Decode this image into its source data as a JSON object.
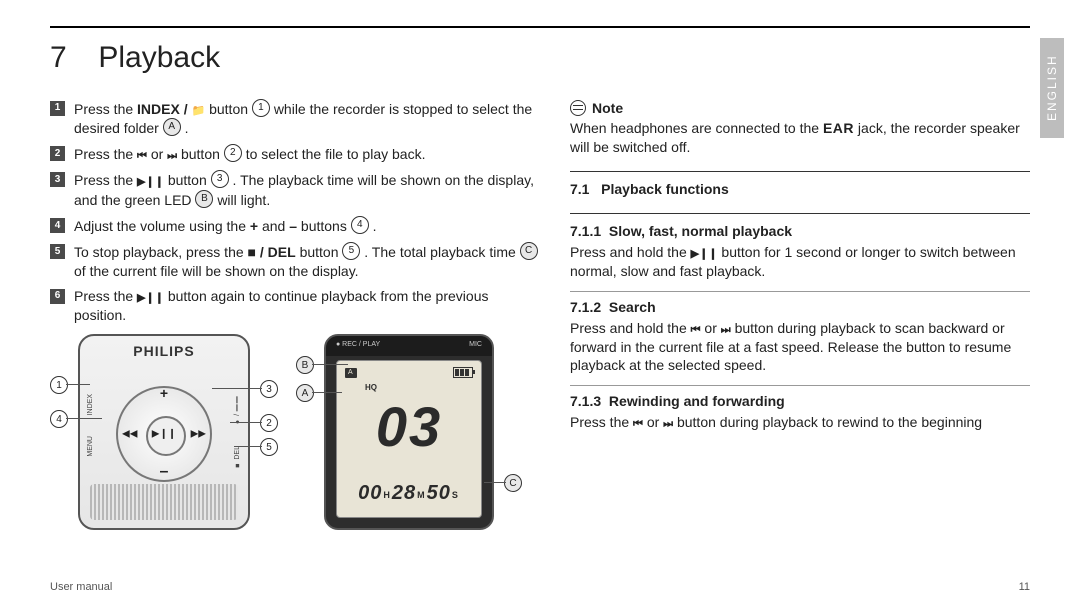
{
  "sideTab": "ENGLISH",
  "chapter": {
    "num": "7",
    "title": "Playback"
  },
  "steps": [
    {
      "pre": "Press the ",
      "btn": "INDEX / ",
      "btnGlyph": "📁",
      "mid1": " button ",
      "ref": "1",
      "mid2": " while the recorder is stopped to select the desired folder ",
      "ref2": "A",
      "end": "."
    },
    {
      "pre": "Press the ",
      "g1": "⏮",
      "or": " or ",
      "g2": "⏭",
      "mid1": " button ",
      "ref": "2",
      "end": " to select the file to play back."
    },
    {
      "pre": "Press the ",
      "g1": "▶❙❙",
      "mid1": " button ",
      "ref": "3",
      "end": ". The playback time will be shown on the display, and the green LED ",
      "ref2": "B",
      "end2": " will light."
    },
    {
      "pre": "Adjust the volume using the ",
      "b1": "+",
      "and": " and ",
      "b2": "–",
      "mid1": " buttons ",
      "ref": "4",
      "end": "."
    },
    {
      "pre": "To stop playback, press the ",
      "btn": "■ / DEL",
      "mid1": " button ",
      "ref": "5",
      "end": ". The total playback time ",
      "ref2": "C",
      "end2": " of the current file will be shown on the display."
    },
    {
      "pre": "Press the ",
      "g1": "▶❙❙",
      "end": " button again to continue playback from the previous position."
    }
  ],
  "device": {
    "brand": "PHILIPS",
    "plus": "+",
    "minus": "–",
    "left": "◀◀",
    "right": "▶▶",
    "center": "▶❙❙",
    "sideLeft1": "INDEX",
    "sideLeft2": "MENU",
    "sideRight1": "● / ❙❙",
    "sideRight2": "■ DEL"
  },
  "deviceCallouts": {
    "c1": "1",
    "c4": "4",
    "c3": "3",
    "c2": "2",
    "c5": "5"
  },
  "lcd": {
    "topLeft": "● REC / PLAY",
    "topRight": "MIC",
    "hq": "HQ",
    "big": "03",
    "h": "00",
    "m": "28",
    "s": "50",
    "uH": "H",
    "uM": "M",
    "uS": "S"
  },
  "lcdCallouts": {
    "B": "B",
    "A": "A",
    "C": "C"
  },
  "note": {
    "label": "Note",
    "text1": "When headphones are connected to the ",
    "ear": "EAR",
    "text2": " jack, the recorder speaker will be switched off."
  },
  "sec71": {
    "num": "7.1",
    "title": "Playback functions"
  },
  "sec711": {
    "num": "7.1.1",
    "title": "Slow, fast, normal playback",
    "t1": "Press and hold the ",
    "g": "▶❙❙",
    "t2": " button for 1 second or longer to switch between normal, slow and fast playback."
  },
  "sec712": {
    "num": "7.1.2",
    "title": "Search",
    "t1": "Press and hold the ",
    "g1": "⏮",
    "or": " or ",
    "g2": "⏭",
    "t2": " button during playback to scan backward or forward in the current file at a fast speed. Release the button to resume playback at the selected speed."
  },
  "sec713": {
    "num": "7.1.3",
    "title": "Rewinding and forwarding",
    "t1": "Press the ",
    "g1": "⏮",
    "or": " or ",
    "g2": "⏭",
    "t2": " button during playback to rewind to the beginning"
  },
  "footer": {
    "left": "User manual",
    "right": "11"
  }
}
